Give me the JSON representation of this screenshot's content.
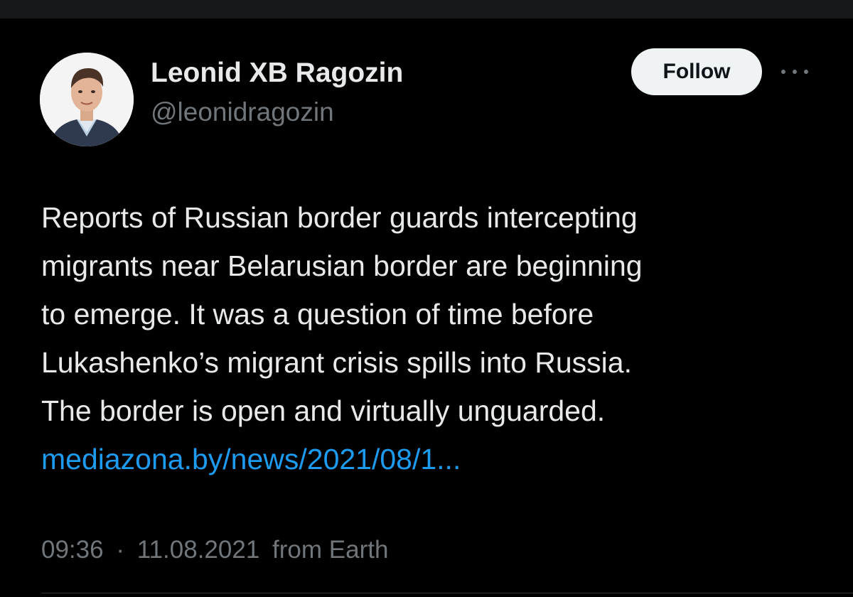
{
  "author": {
    "display_name": "Leonid XB Ragozin",
    "handle": "@leonidragozin"
  },
  "actions": {
    "follow_label": "Follow",
    "more_icon": "more-horizontal-icon"
  },
  "tweet": {
    "text_lines": [
      "Reports of Russian border guards intercepting",
      "migrants near Belarusian border are beginning",
      "to emerge. It was a question of time before",
      "Lukashenko’s migrant crisis spills into Russia.",
      "The border is open and virtually unguarded."
    ],
    "link_text": "mediazona.by/news/2021/08/1..."
  },
  "meta": {
    "time": "09:36",
    "separator": "·",
    "date": "11.08.2021",
    "source": "from Earth"
  },
  "colors": {
    "background": "#000000",
    "text": "#e7e9ea",
    "secondary": "#71767b",
    "link": "#1d9bf0",
    "follow_bg": "#eff3f4"
  }
}
